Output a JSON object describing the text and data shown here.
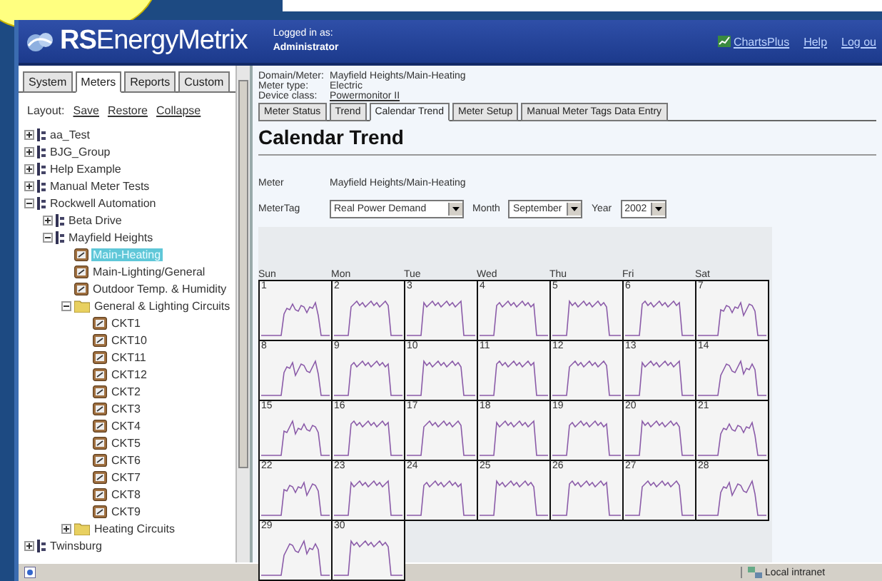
{
  "header": {
    "logo": "**RS**EnergyMetrix",
    "logged_in_label": "Logged in as:",
    "user": "Administrator",
    "links": [
      "ChartsPlus",
      "Help",
      "Log ou"
    ]
  },
  "sidebar": {
    "tabs": [
      {
        "label": "System",
        "selected": false
      },
      {
        "label": "Meters",
        "selected": true
      },
      {
        "label": "Reports",
        "selected": false
      },
      {
        "label": "Custom",
        "selected": false
      }
    ],
    "layout_label": "Layout:",
    "layout_links": [
      "Save",
      "Restore",
      "Collapse"
    ],
    "tree": [
      {
        "label": "aa_Test",
        "kind": "group",
        "expanded": false
      },
      {
        "label": "BJG_Group",
        "kind": "group",
        "expanded": false
      },
      {
        "label": "Help Example",
        "kind": "group",
        "expanded": false
      },
      {
        "label": "Manual Meter Tests",
        "kind": "group",
        "expanded": false
      },
      {
        "label": "Rockwell Automation",
        "kind": "group",
        "expanded": true,
        "children": [
          {
            "label": "Beta Drive",
            "kind": "group",
            "expanded": false
          },
          {
            "label": "Mayfield Heights",
            "kind": "group",
            "expanded": true,
            "children": [
              {
                "label": "Main-Heating",
                "kind": "meter",
                "selected": true
              },
              {
                "label": "Main-Lighting/General",
                "kind": "meter",
                "selected": false
              },
              {
                "label": "Outdoor Temp. & Humidity",
                "kind": "meter",
                "selected": false
              },
              {
                "label": "General & Lighting Circuits",
                "kind": "folder",
                "expanded": true,
                "children": [
                  {
                    "label": "CKT1",
                    "kind": "meter",
                    "selected": false
                  },
                  {
                    "label": "CKT10",
                    "kind": "meter",
                    "selected": false
                  },
                  {
                    "label": "CKT11",
                    "kind": "meter",
                    "selected": false
                  },
                  {
                    "label": "CKT12",
                    "kind": "meter",
                    "selected": false
                  },
                  {
                    "label": "CKT2",
                    "kind": "meter",
                    "selected": false
                  },
                  {
                    "label": "CKT3",
                    "kind": "meter",
                    "selected": false
                  },
                  {
                    "label": "CKT4",
                    "kind": "meter",
                    "selected": false
                  },
                  {
                    "label": "CKT5",
                    "kind": "meter",
                    "selected": false
                  },
                  {
                    "label": "CKT6",
                    "kind": "meter",
                    "selected": false
                  },
                  {
                    "label": "CKT7",
                    "kind": "meter",
                    "selected": false
                  },
                  {
                    "label": "CKT8",
                    "kind": "meter",
                    "selected": false
                  },
                  {
                    "label": "CKT9",
                    "kind": "meter",
                    "selected": false
                  }
                ]
              },
              {
                "label": "Heating Circuits",
                "kind": "folder",
                "expanded": false
              }
            ]
          }
        ]
      },
      {
        "label": "Twinsburg",
        "kind": "group",
        "expanded": false
      }
    ]
  },
  "info": [
    {
      "label": "Domain/Meter:",
      "value": "Mayfield Heights/Main-Heating",
      "kind": "text"
    },
    {
      "label": "Meter type:",
      "value": "Electric",
      "kind": "text"
    },
    {
      "label": "Device class:",
      "value": "Powermonitor II",
      "kind": "link"
    }
  ],
  "tabs": [
    {
      "label": "Meter Status",
      "selected": false
    },
    {
      "label": "Trend",
      "selected": false
    },
    {
      "label": "Calendar Trend",
      "selected": true
    },
    {
      "label": "Meter Setup",
      "selected": false
    },
    {
      "label": "Manual Meter Tags Data Entry",
      "selected": false
    }
  ],
  "title": "Calendar Trend",
  "meter": {
    "label": "Meter",
    "value": "Mayfield Heights/Main-Heating"
  },
  "filters": [
    {
      "label": "MeterTag",
      "value": "Real Power Demand"
    },
    {
      "label": "Month",
      "value": "September"
    },
    {
      "label": "Year",
      "value": "2002"
    }
  ],
  "calendar": {
    "weekdays": [
      "Sun",
      "Mon",
      "Tue",
      "Wed",
      "Thu",
      "Fri",
      "Sat"
    ],
    "weeks": [
      [
        "1",
        "2",
        "3",
        "4",
        "5",
        "6",
        "7"
      ],
      [
        "8",
        "9",
        "10",
        "11",
        "12",
        "13",
        "14"
      ],
      [
        "15",
        "16",
        "17",
        "18",
        "19",
        "20",
        "21"
      ],
      [
        "22",
        "23",
        "24",
        "25",
        "26",
        "27",
        "28"
      ],
      [
        "29",
        "30"
      ]
    ]
  },
  "status_bar": {
    "zone": "Local intranet"
  }
}
